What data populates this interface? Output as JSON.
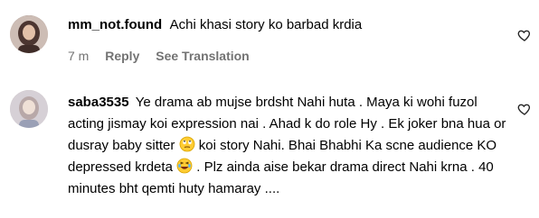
{
  "comments": [
    {
      "username": "mm_not.found",
      "text": "Achi khasi story ko barbad krdia",
      "time": "7 m",
      "reply_label": "Reply",
      "translation_label": "See Translation"
    },
    {
      "username": "saba3535",
      "text_part1": "Ye drama ab mujse brdsht Nahi huta . Maya ki wohi fuzol acting jismay koi expression nai . Ahad k do role Hy . Ek joker bna hua or dusray baby sitter",
      "text_part2": " koi story Nahi. Bhai Bhabhi Ka scne audience KO depressed krdeta",
      "text_part3": " . Plz ainda aise bekar drama direct Nahi krna . 40 minutes bht qemti huty hamaray ....",
      "emoji1": "eye-roll-emoji",
      "emoji2": "laughing-emoji"
    }
  ],
  "icons": {
    "like": "heart-outline-icon"
  },
  "colors": {
    "meta": "#737373",
    "text": "#000000"
  }
}
